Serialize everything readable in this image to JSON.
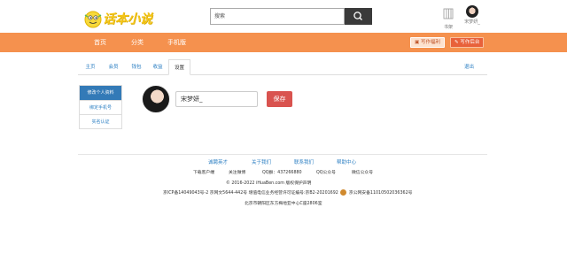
{
  "header": {
    "logo_text": "话本小说",
    "search": {
      "value": "搜索"
    },
    "shelf_label": "书架",
    "user_name": "宋梦妍_"
  },
  "nav": {
    "items": [
      "首页",
      "分类",
      "手机版"
    ],
    "write_novel": "写作福利",
    "write_backend": "写作后台"
  },
  "tabs": {
    "items": [
      "主页",
      "会员",
      "钱包",
      "收益",
      "设置"
    ],
    "active_index": 4,
    "logout": "退出"
  },
  "side_menu": {
    "items": [
      "修改个人资料",
      "绑定手机号",
      "实名认证"
    ],
    "active_index": 0
  },
  "profile": {
    "name_value": "宋梦妍_",
    "save_label": "保存"
  },
  "footer": {
    "links": [
      "诚聘英才",
      "关于我们",
      "联系我们",
      "帮助中心"
    ],
    "line1": [
      "下载客户端",
      "关注微博",
      "QQ群：437266880",
      "QQ公众号",
      "微信公众号"
    ],
    "copyright": "© 2016-2022 iHuaBen.com 版权保护声明",
    "icp": "京ICP备14049043号-2 京网文5644-442号 增值电信业务经营许可证编号:京B2-20201692",
    "police": "京公网安备11010502036362号",
    "address": "北京市朝阳区东方梅地亚中心C座2806室"
  },
  "colors": {
    "nav_bg": "#f5914e",
    "active_menu": "#337ab7",
    "save_btn": "#d9534f",
    "link": "#2a7ec2"
  }
}
